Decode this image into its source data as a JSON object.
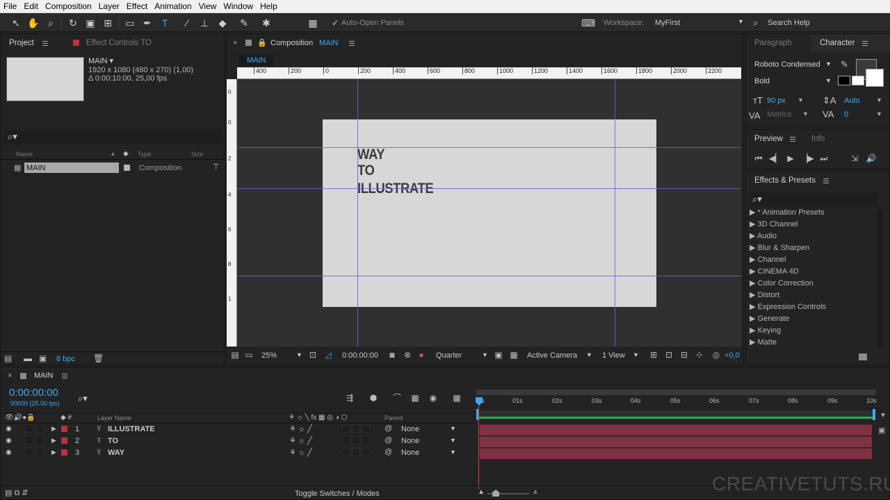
{
  "menu": [
    "File",
    "Edit",
    "Composition",
    "Layer",
    "Effect",
    "Animation",
    "View",
    "Window",
    "Help"
  ],
  "toolbar": {
    "auto_open_label": "Auto-Open Panels",
    "workspace_label": "Workspace:",
    "workspace_value": "MyFirst",
    "search_help": "Search Help"
  },
  "project": {
    "tab_project": "Project",
    "tab_effect_controls": "Effect Controls TO",
    "item_name": "MAIN ▾",
    "item_size": "1920 x 1080  (480 x 270) (1,00)",
    "item_duration": "Δ 0:00:10:00, 25,00 fps",
    "col_name": "Name",
    "col_type": "Type",
    "col_size": "Size",
    "row_name": "MAIN",
    "row_type": "Composition",
    "bpc": "8 bpc"
  },
  "composition": {
    "tab_label": "Composition",
    "tab_comp": "MAIN",
    "subtab": "MAIN",
    "ruler_ticks": [
      "400",
      "200",
      "0",
      "200",
      "400",
      "600",
      "800",
      "1000",
      "1200",
      "1400",
      "1600",
      "1800",
      "2000",
      "2200"
    ],
    "ruler_v_ticks": [
      "0",
      "0",
      "2",
      "4",
      "6",
      "8",
      "1"
    ],
    "canvas_lines": [
      "WAY",
      "TO",
      "ILLUSTRATE"
    ],
    "zoom": "25%",
    "timecode": "0:00:00:00",
    "resolution": "Quarter",
    "camera": "Active Camera",
    "views": "1 View",
    "exposure": "+0,0"
  },
  "character": {
    "tab_paragraph": "Paragraph",
    "tab_character": "Character",
    "font": "Roboto Condensed",
    "style": "Bold",
    "size": "90 px",
    "leading": "Auto",
    "kerning": "Metrics",
    "tracking": "0"
  },
  "preview": {
    "tab_preview": "Preview",
    "tab_info": "Info"
  },
  "effects": {
    "title": "Effects & Presets",
    "items": [
      "▶ * Animation Presets",
      "▶ 3D Channel",
      "▶ Audio",
      "▶ Blur & Sharpen",
      "▶ Channel",
      "▶ CINEMA 4D",
      "▶ Color Correction",
      "▶ Distort",
      "▶ Expression Controls",
      "▶ Generate",
      "▶ Keying",
      "▶ Matte"
    ]
  },
  "timeline": {
    "tab": "MAIN",
    "timecode": "0:00:00:00",
    "frames": "00000 (25.00 fps)",
    "col_layer_name": "Layer Name",
    "col_parent": "Parent",
    "ruler": [
      "0s",
      "01s",
      "02s",
      "03s",
      "04s",
      "05s",
      "06s",
      "07s",
      "08s",
      "09s",
      "10s"
    ],
    "layers": [
      {
        "num": "1",
        "name": "ILLUSTRATE",
        "parent": "None"
      },
      {
        "num": "2",
        "name": "TO",
        "parent": "None"
      },
      {
        "num": "3",
        "name": "WAY",
        "parent": "None"
      }
    ],
    "toggle_label": "Toggle Switches / Modes"
  },
  "watermark": "CREATIVETUTS.RU",
  "colors": {
    "accent": "#3fa9f5",
    "label_red": "#b8323e",
    "guide": "#6c5fd6",
    "bar": "#7e3344"
  }
}
